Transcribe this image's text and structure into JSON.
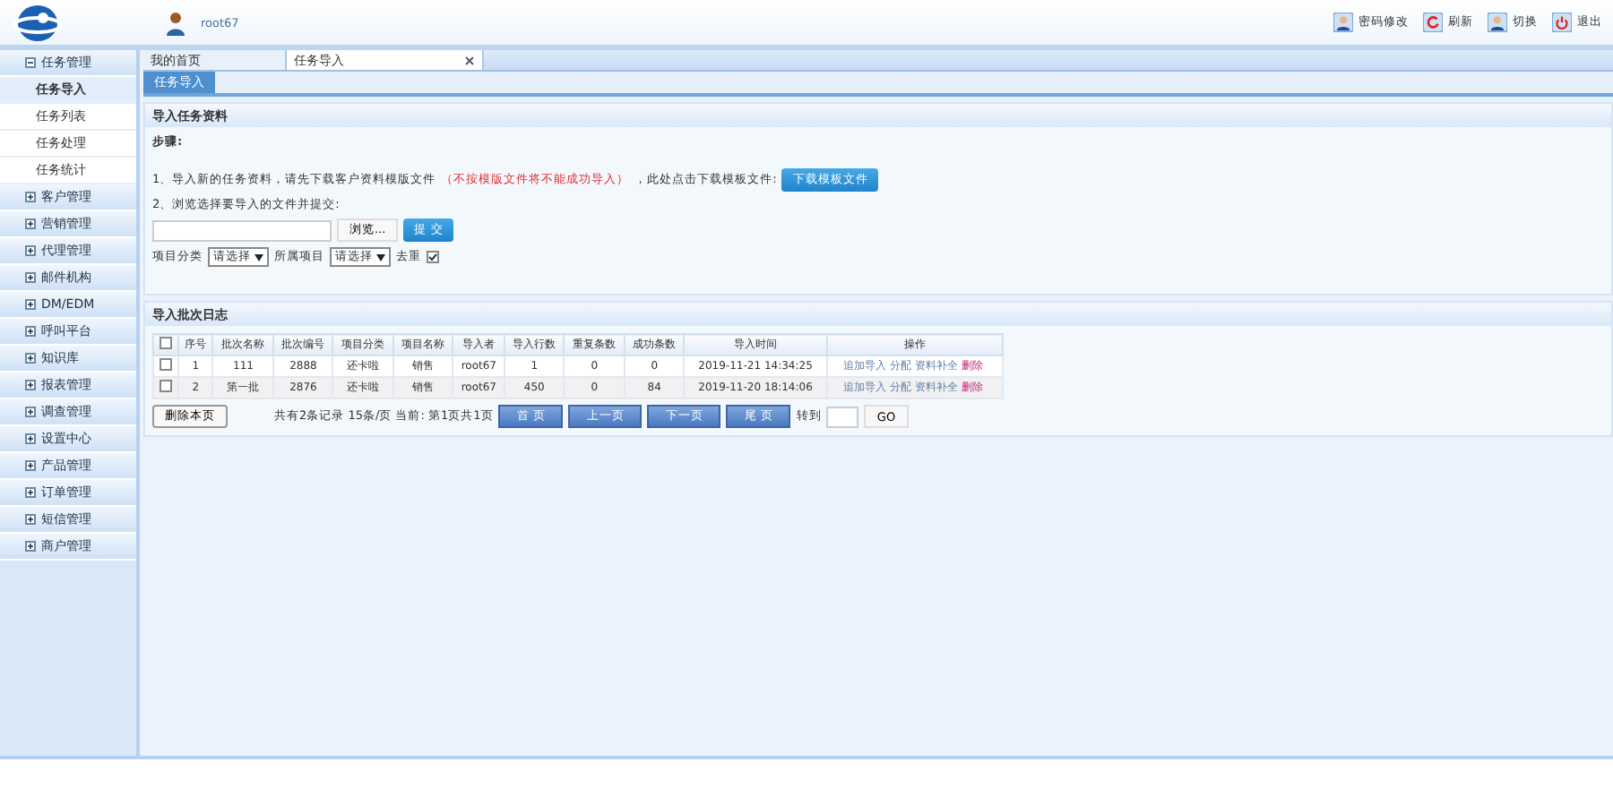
{
  "header": {
    "username": "root67",
    "actions": [
      {
        "kind": "user",
        "label": "密码修改"
      },
      {
        "kind": "refresh",
        "label": "刷新"
      },
      {
        "kind": "user",
        "label": "切换"
      },
      {
        "kind": "power",
        "label": "退出"
      }
    ]
  },
  "sidebar": {
    "items": [
      {
        "label": "任务管理",
        "expanded": true,
        "children": [
          {
            "label": "任务导入",
            "selected": true
          },
          {
            "label": "任务列表",
            "selected": false
          },
          {
            "label": "任务处理",
            "selected": false
          },
          {
            "label": "任务统计",
            "selected": false
          }
        ]
      },
      {
        "label": "客户管理",
        "expanded": false
      },
      {
        "label": "营销管理",
        "expanded": false
      },
      {
        "label": "代理管理",
        "expanded": false
      },
      {
        "label": "邮件机构",
        "expanded": false
      },
      {
        "label": "DM/EDM",
        "expanded": false
      },
      {
        "label": "呼叫平台",
        "expanded": false
      },
      {
        "label": "知识库",
        "expanded": false
      },
      {
        "label": "报表管理",
        "expanded": false
      },
      {
        "label": "调查管理",
        "expanded": false
      },
      {
        "label": "设置中心",
        "expanded": false
      },
      {
        "label": "产品管理",
        "expanded": false
      },
      {
        "label": "订单管理",
        "expanded": false
      },
      {
        "label": "短信管理",
        "expanded": false
      },
      {
        "label": "商户管理",
        "expanded": false
      }
    ]
  },
  "tabs": [
    {
      "label": "我的首页",
      "selected": false,
      "closable": false
    },
    {
      "label": "任务导入",
      "selected": true,
      "closable": true
    }
  ],
  "subtab": "任务导入",
  "import_panel": {
    "title": "导入任务资料",
    "steps_label": "步骤:",
    "step1": "1、导入新的任务资料，请先下载客户资料模版文件",
    "step1_warning": "（不按模版文件将不能成功导入）",
    "step1_tail": "，此处点击下载模板文件:",
    "download_button": "下载模板文件",
    "step2": "2、浏览选择要导入的文件并提交:",
    "browse_button": "浏览...",
    "submit_button": "提 交",
    "category_label": "项目分类",
    "category_value": "请选择",
    "project_label": "所属项目",
    "project_value": "请选择",
    "dedupe_label": "去重",
    "dedupe_checked": true
  },
  "log_panel": {
    "title": "导入批次日志",
    "columns": [
      "序号",
      "批次名称",
      "批次编号",
      "项目分类",
      "项目名称",
      "导入者",
      "导入行数",
      "重复条数",
      "成功条数",
      "导入时间",
      "操作"
    ],
    "all_checked": false,
    "rows": [
      {
        "checked": false,
        "cells": [
          "1",
          "111",
          "2888",
          "还卡啦",
          "销售",
          "root67",
          "1",
          "0",
          "0",
          "2019-11-21 14:34:25"
        ],
        "actions": [
          "追加导入",
          "分配",
          "资料补全",
          "删除"
        ]
      },
      {
        "checked": false,
        "cells": [
          "2",
          "第一批",
          "2876",
          "还卡啦",
          "销售",
          "root67",
          "450",
          "0",
          "84",
          "2019-11-20 18:14:06"
        ],
        "actions": [
          "追加导入",
          "分配",
          "资料补全",
          "删除"
        ]
      }
    ],
    "delete_page_button": "删除本页",
    "summary": "共有2条记录 15条/页 当前: 第1页共1页",
    "pager": [
      "首 页",
      "上一页",
      "下一页",
      "尾 页"
    ],
    "goto_label": "转到",
    "go_button": "GO"
  }
}
